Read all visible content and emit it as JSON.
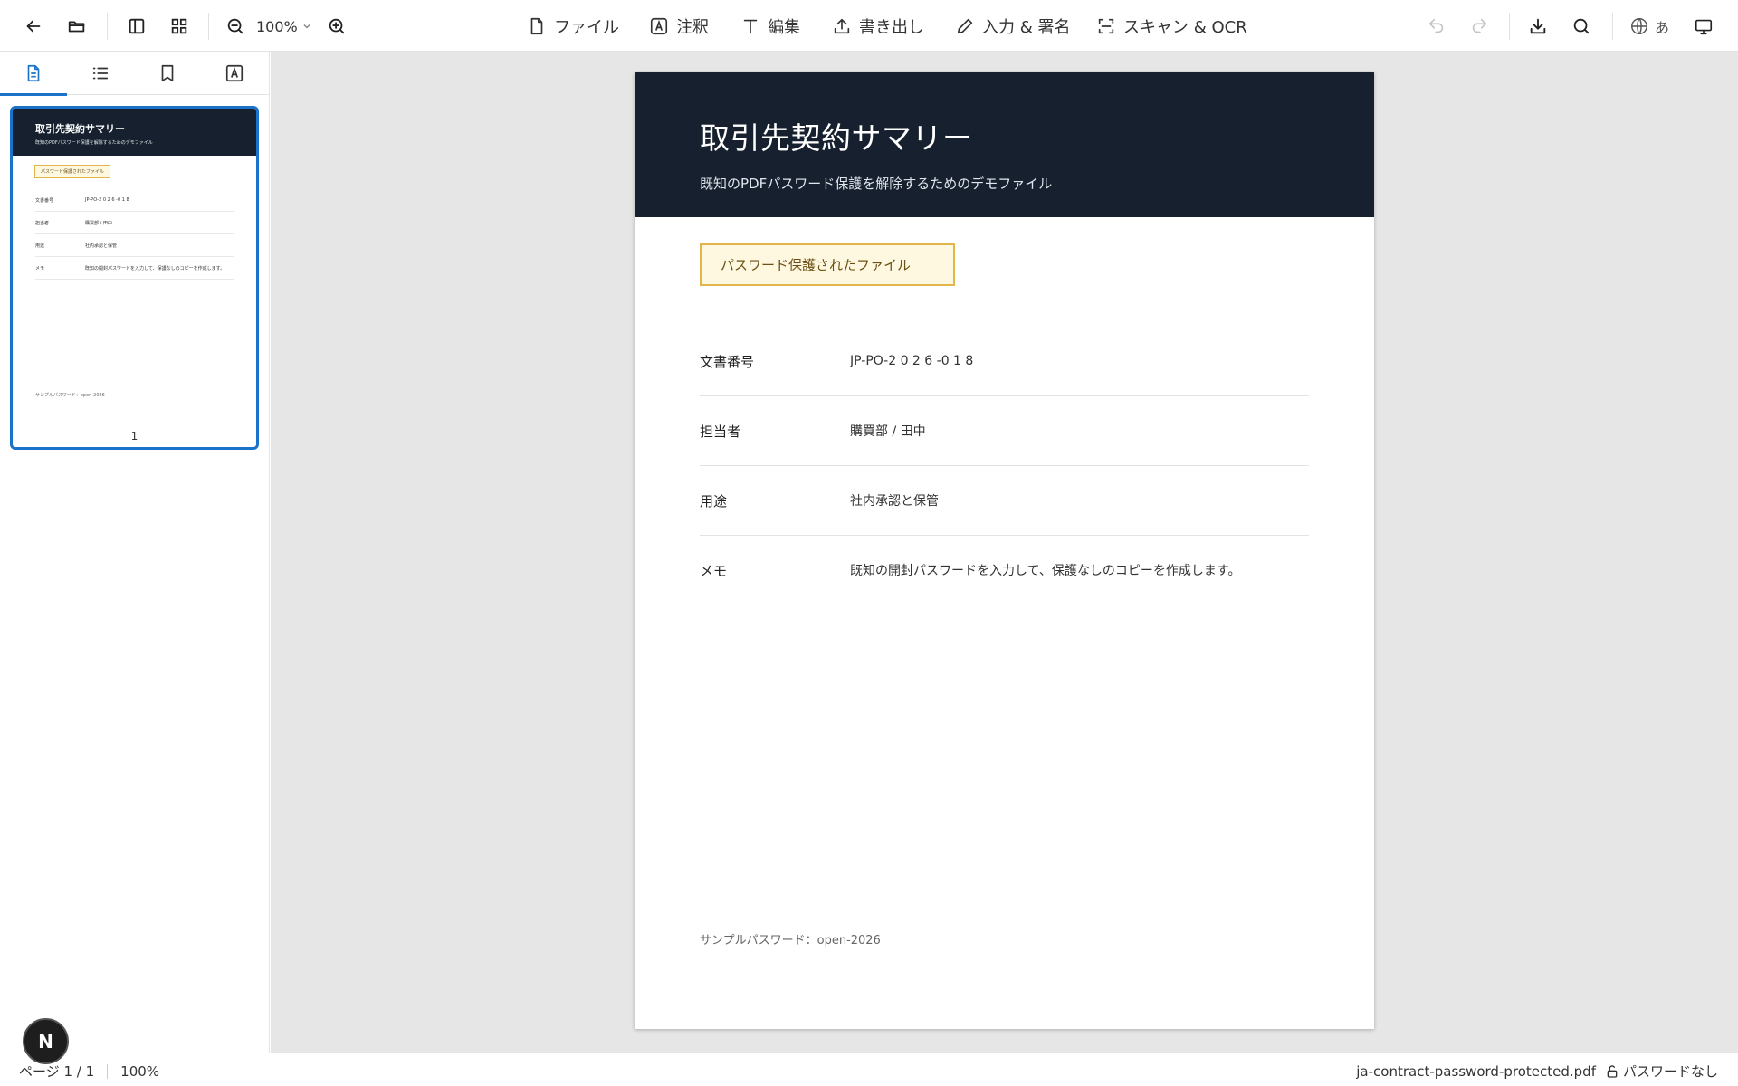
{
  "toolbar": {
    "zoom_value": "100%",
    "menu": {
      "file": "ファイル",
      "annotate": "注釈",
      "edit": "編集",
      "export": "書き出し",
      "fill_sign": "入力 & 署名",
      "scan_ocr": "スキャン & OCR"
    },
    "language_label": "あ"
  },
  "icons": {
    "back": "arrow-left-icon",
    "open": "folder-open-icon",
    "sidebar_toggle": "sidebar-icon",
    "grid": "grid-icon",
    "zoom_out": "zoom-out-icon",
    "zoom_in": "zoom-in-icon",
    "undo": "undo-icon",
    "redo": "redo-icon",
    "download": "download-icon",
    "search": "search-icon",
    "language": "globe-icon",
    "presentation": "monitor-icon"
  },
  "sidebar": {
    "thumbnail": {
      "title": "取引先契約サマリー",
      "subtitle": "既知のPDFパスワード保護を解除するためのデモファイル",
      "badge": "パスワード保護されたファイル",
      "rows": [
        {
          "label": "文書番号",
          "value": "JP-PO-2 0 2 6 -0 1 8"
        },
        {
          "label": "担当者",
          "value": "購買部 / 田中"
        },
        {
          "label": "用途",
          "value": "社内承認と保管"
        },
        {
          "label": "メモ",
          "value": "既知の開封パスワードを入力して、保護なしのコピーを作成します。"
        }
      ],
      "footer": "サンプルパスワード：open-2026",
      "page_number": "1"
    }
  },
  "document": {
    "title": "取引先契約サマリー",
    "subtitle": "既知のPDFパスワード保護を解除するためのデモファイル",
    "badge": "パスワード保護されたファイル",
    "rows": [
      {
        "label": "文書番号",
        "value": "JP-PO-2 0 2 6 -0 1 8"
      },
      {
        "label": "担当者",
        "value": "購買部 / 田中"
      },
      {
        "label": "用途",
        "value": "社内承認と保管"
      },
      {
        "label": "メモ",
        "value": "既知の開封パスワードを入力して、保護なしのコピーを作成します。"
      }
    ],
    "footer": "サンプルパスワード：open-2026"
  },
  "statusbar": {
    "page_indicator": "ページ 1 / 1",
    "zoom": "100%",
    "filename": "ja-contract-password-protected.pdf",
    "protection": "パスワードなし"
  },
  "fab_label": "N",
  "colors": {
    "accent": "#1a73c9",
    "header_bg": "#16202e",
    "badge_border": "#e2b64a",
    "badge_bg": "#fff8e1"
  }
}
